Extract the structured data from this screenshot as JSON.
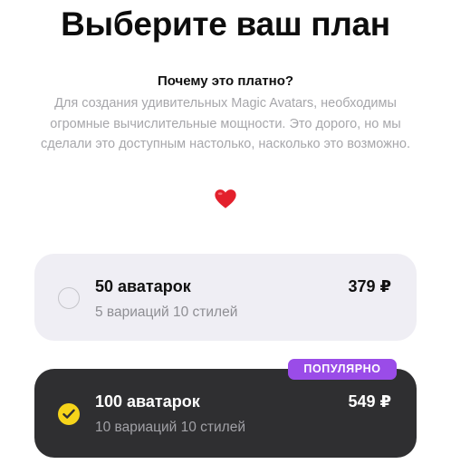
{
  "header": {
    "title": "Выберите ваш план"
  },
  "info": {
    "heading": "Почему это платно?",
    "body": "Для создания удивительных Magic Avatars, необходимы огромные вычислительные мощности. Это дорого, но мы сделали это доступным настолько, насколько это возможно.",
    "emoji_icon": "heart-icon"
  },
  "plans": [
    {
      "name": "50 аватарок",
      "details": "5 вариаций 10 стилей",
      "price": "379 ₽",
      "selected": false
    },
    {
      "name": "100 аватарок",
      "details": "10 вариаций 10 стилей",
      "price": "549 ₽",
      "selected": true,
      "badge": "ПОПУЛЯРНО"
    }
  ],
  "colors": {
    "accent_check": "#f6d41a",
    "badge": "#9a4ce8",
    "selected_card": "#2f2f31",
    "unselected_card": "#efeef4"
  }
}
